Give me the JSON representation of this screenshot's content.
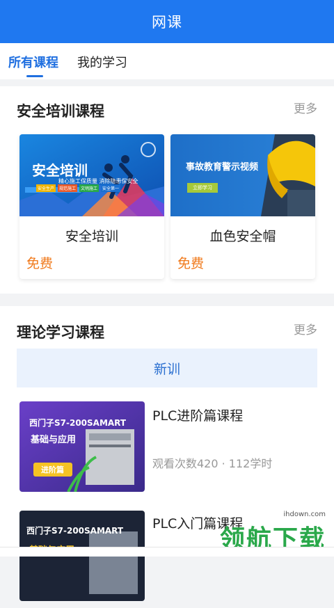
{
  "appbar": {
    "title": "网课"
  },
  "tabs": [
    {
      "label": "所有课程",
      "active": true
    },
    {
      "label": "我的学习",
      "active": false
    }
  ],
  "safety": {
    "title": "安全培训课程",
    "more": "更多",
    "cards": [
      {
        "title": "安全培训",
        "price": "免费",
        "banner_heading": "安全培训",
        "banner_sub": "精心施工保质量 消除隐患保安全",
        "banner_tags": [
          "安全生产",
          "规范施工",
          "文明施工",
          "安全第一"
        ]
      },
      {
        "title": "血色安全帽",
        "price": "免费",
        "banner_heading": "事故教育警示视频",
        "banner_button": "立即学习"
      }
    ]
  },
  "theory": {
    "title": "理论学习课程",
    "more": "更多",
    "subtab": "新训",
    "courses": [
      {
        "title": "PLC进阶篇课程",
        "meta": "观看次数420 · 112学时",
        "thumb_line1": "西门子S7-200SAMART",
        "thumb_line2": "基础与应用",
        "thumb_badge": "进阶篇"
      },
      {
        "title": "PLC入门篇课程",
        "meta": "",
        "thumb_line1": "西门子S7-200SAMART",
        "thumb_line2": "基础与应用"
      }
    ]
  },
  "watermark": {
    "site": "ihdown.com",
    "text": "领航下载"
  },
  "colors": {
    "primary": "#1f78f0",
    "price": "#f07a1c",
    "more": "#999999"
  }
}
